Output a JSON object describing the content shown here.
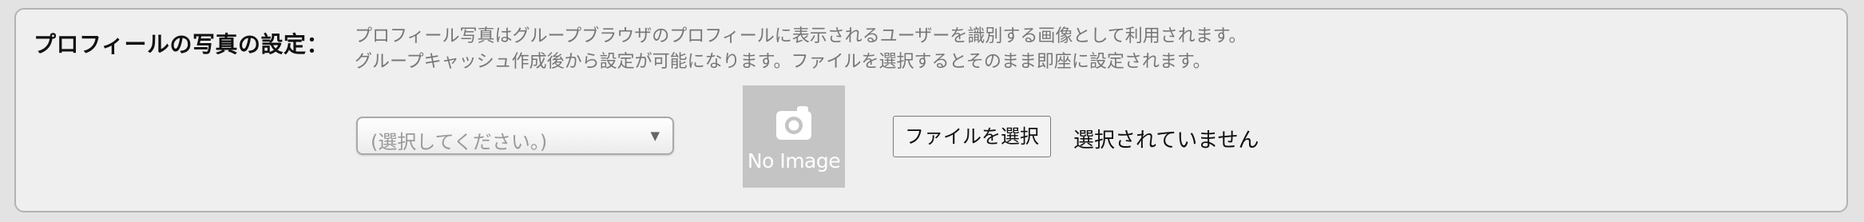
{
  "setting": {
    "label": "プロフィールの写真の設定：",
    "description": [
      "プロフィール写真はグループブラウザのプロフィールに表示されるユーザーを識別する画像として利用されます。",
      "グループキャッシュ作成後から設定が可能になります。ファイルを選択するとそのまま即座に設定されます。"
    ]
  },
  "select": {
    "value": "(選択してください。)",
    "arrow": "▼"
  },
  "preview": {
    "icon": "camera-icon",
    "text": "No Image"
  },
  "file_input": {
    "button_label": "ファイルを選択",
    "status": "選択されていません"
  }
}
